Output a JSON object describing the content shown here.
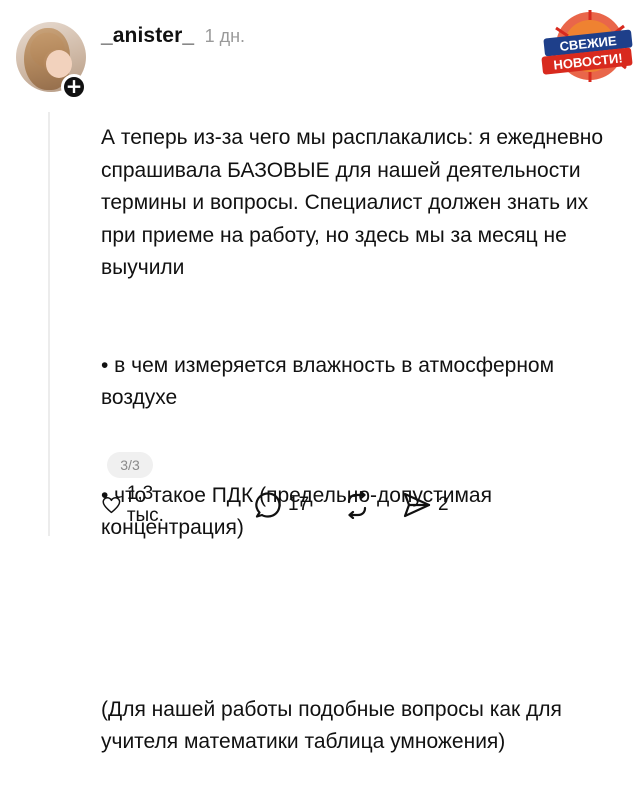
{
  "comment": {
    "username": "_anister_",
    "time": "1 дн.",
    "paragraphs": [
      "А теперь из-за чего мы расплакались: я ежедневно спрашивала БАЗОВЫЕ для нашей деятельности термины и вопросы. Специалист должен знать их при приеме на работу, но здесь мы за месяц не выучили",
      "• в чем измеряется влажность в атмосферном воздухе",
      "• что такое ПДК (предельно-допустимая концентрация)",
      "(Для нашей работы подобные вопросы как для учителя математики таблица умножения)"
    ],
    "page_indicator": "3/3"
  },
  "actions": {
    "likes": "1,3 тыс.",
    "replies": "17",
    "reposts": "",
    "shares": "2"
  },
  "watermark": {
    "line1": "СВЕЖИЕ",
    "line2": "НОВОСТИ!"
  },
  "icons": {
    "avatar": "avatar-photo",
    "follow": "plus-icon",
    "like": "heart-icon",
    "reply": "comment-bubble-icon",
    "repost": "repost-icon",
    "share": "send-icon"
  },
  "colors": {
    "text": "#111111",
    "muted": "#9a9a9a",
    "watermark_red": "#d82a1e",
    "watermark_blue": "#1e3f8a"
  }
}
